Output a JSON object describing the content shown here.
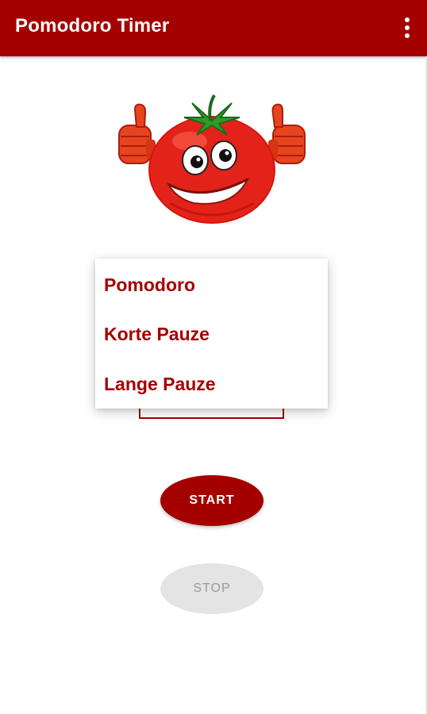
{
  "app": {
    "title": "Pomodoro Timer",
    "accent_color": "#a50000"
  },
  "toolbar": {
    "overflow_icon": "more-vert-icon"
  },
  "mascot": {
    "icon": "tomato-thumbs-up-icon"
  },
  "timer_type_dropdown": {
    "options": [
      "Pomodoro",
      "Korte Pauze",
      "Lange Pauze"
    ]
  },
  "controls": {
    "start_label": "START",
    "stop_label": "STOP",
    "stop_enabled": false
  }
}
